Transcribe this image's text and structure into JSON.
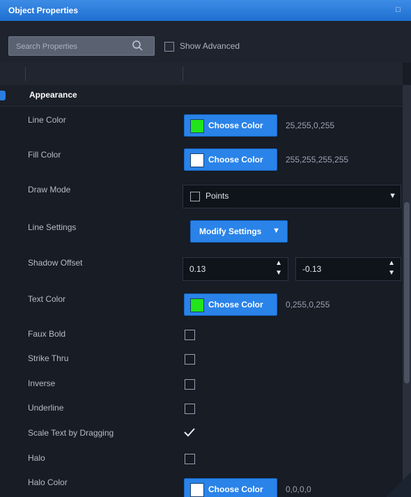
{
  "window": {
    "title": "Object Properties"
  },
  "search": {
    "placeholder": "Search Properties",
    "advanced_label": "Show Advanced"
  },
  "section": {
    "title": "Appearance"
  },
  "properties": {
    "line_color": {
      "label": "Line Color",
      "button": "Choose Color",
      "value": "25,255,0,255",
      "swatch": "#22e41a"
    },
    "fill_color": {
      "label": "Fill Color",
      "button": "Choose Color",
      "value": "255,255,255,255",
      "swatch": "#ffffff"
    },
    "draw_mode": {
      "label": "Draw Mode",
      "value": "Points"
    },
    "line_settings": {
      "label": "Line Settings",
      "button": "Modify Settings"
    },
    "shadow_offset": {
      "label": "Shadow Offset",
      "x": "0.13",
      "y": "-0.13"
    },
    "text_color": {
      "label": "Text Color",
      "button": "Choose Color",
      "value": "0,255,0,255",
      "swatch": "#22e41a"
    },
    "faux_bold": {
      "label": "Faux Bold",
      "checked": false
    },
    "strike_thru": {
      "label": "Strike Thru",
      "checked": false
    },
    "inverse": {
      "label": "Inverse",
      "checked": false
    },
    "underline": {
      "label": "Underline",
      "checked": false
    },
    "scale_text": {
      "label": "Scale Text by Dragging",
      "checked": true
    },
    "halo": {
      "label": "Halo",
      "checked": false
    },
    "halo_color": {
      "label": "Halo Color",
      "button": "Choose Color",
      "value": "0,0,0,0",
      "swatch": "#ffffff"
    }
  },
  "colors": {
    "accent": "#2a83e8",
    "panel": "#171c25"
  }
}
